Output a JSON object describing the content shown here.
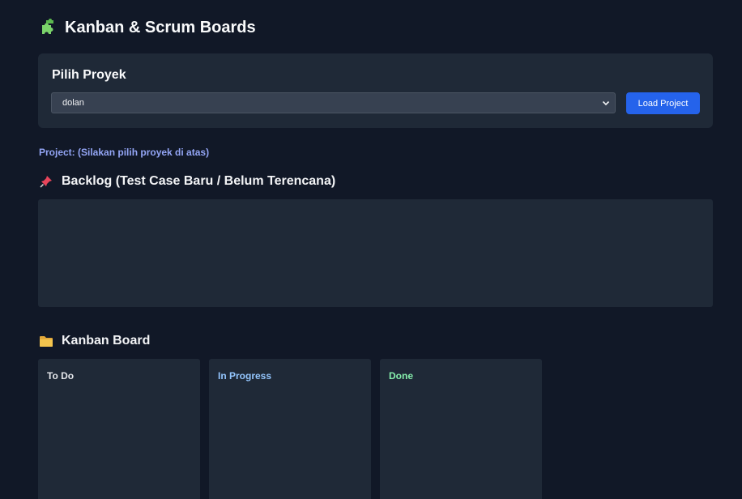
{
  "header": {
    "title": "Kanban & Scrum Boards",
    "icon": "puzzle-icon"
  },
  "project_picker": {
    "title": "Pilih Proyek",
    "selected": "dolan",
    "load_label": "Load Project"
  },
  "project_status": "Project: (Silakan pilih proyek di atas)",
  "backlog": {
    "title": "Backlog (Test Case Baru / Belum Terencana)",
    "icon": "pushpin-icon"
  },
  "kanban": {
    "title": "Kanban Board",
    "icon": "folder-icon",
    "columns": [
      {
        "label": "To Do",
        "color": "#e5e7eb"
      },
      {
        "label": "In Progress",
        "color": "#93c5fd"
      },
      {
        "label": "Done",
        "color": "#86efac"
      }
    ]
  },
  "colors": {
    "background": "#111827",
    "panel": "#1f2937",
    "accent": "#2563eb"
  }
}
